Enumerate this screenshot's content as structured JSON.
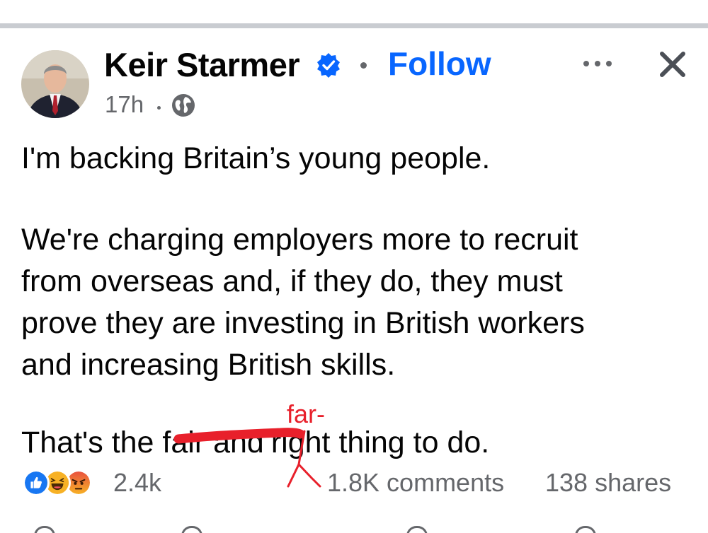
{
  "post": {
    "author": "Keir Starmer",
    "follow_label": "Follow",
    "time": "17h",
    "text": {
      "line1": "I'm backing Britain’s young people.",
      "para2_line1": "We're charging employers more to recruit",
      "para2_line2": "from overseas and, if they do, they must",
      "para2_line2b": "prove they are investing in British workers",
      "para2_line3": "and increasing British skills.",
      "para3_prefix": "That's the ",
      "para3_struck": "fair and",
      "para3_suffix": "right thing to do."
    },
    "annotation": "far-"
  },
  "icons": {
    "avatar": "profile-photo",
    "verified": "verified-badge-icon",
    "more": "more-options-icon",
    "close": "close-icon",
    "audience": "globe-icon",
    "reactions": [
      "like-reaction-icon",
      "haha-reaction-icon",
      "angry-reaction-icon"
    ]
  },
  "engagement": {
    "reaction_count": "2.4k",
    "comments": "1.8K comments",
    "shares": "138 shares"
  },
  "colors": {
    "accent": "#0866ff",
    "secondary_text": "#65676b",
    "annotation_red": "#e8202b",
    "divider": "#c9ccd1"
  }
}
